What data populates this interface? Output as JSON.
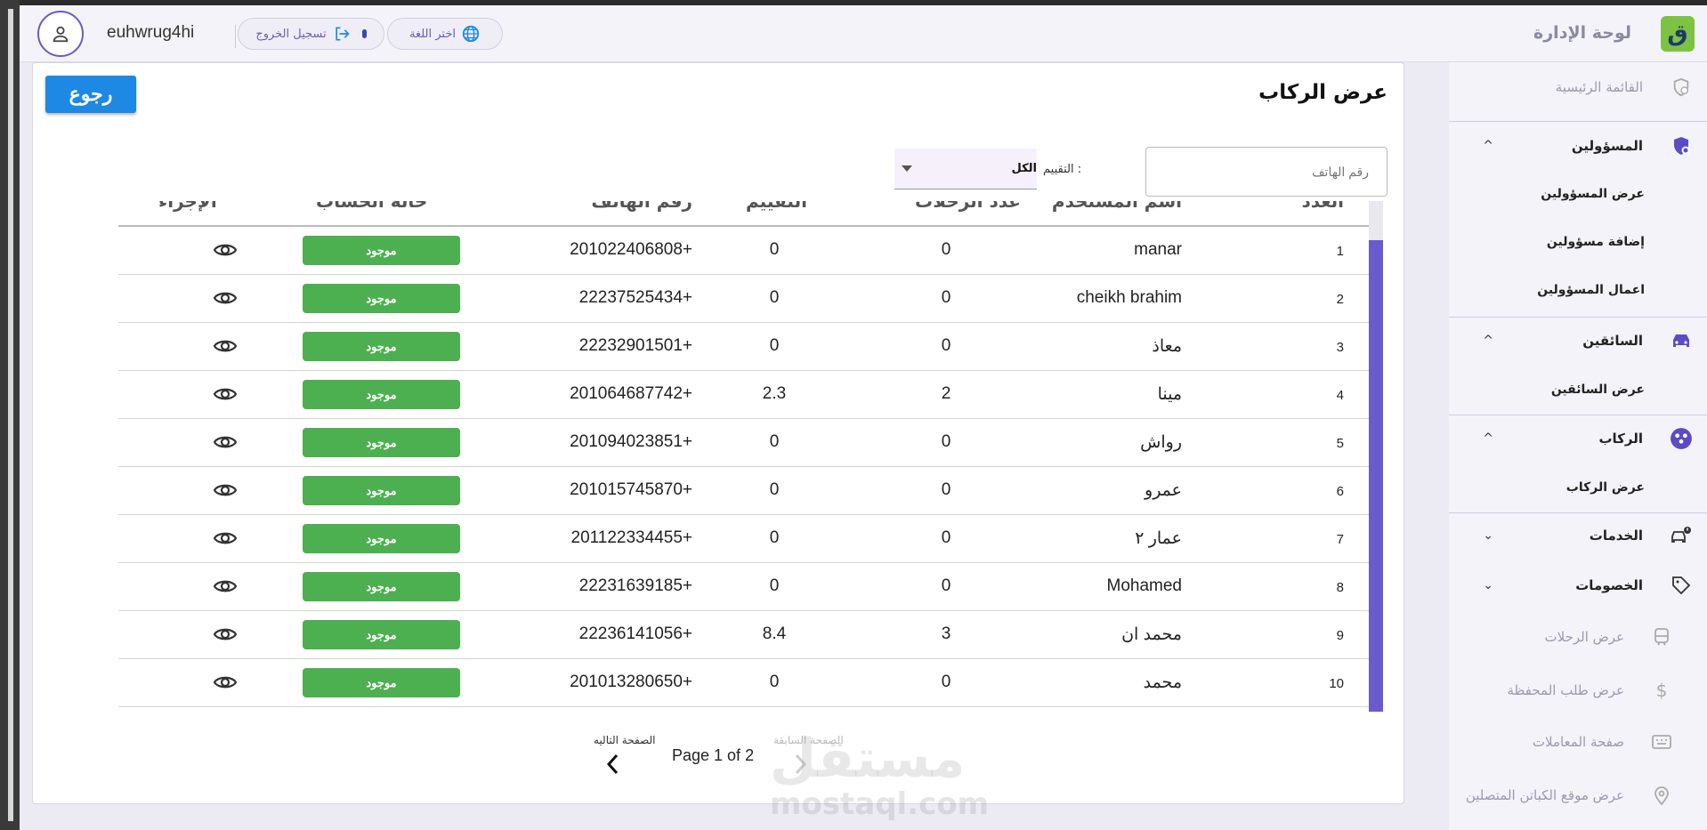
{
  "header": {
    "username": "euhwrug4hi",
    "logout_label": "تسجيل الخروج",
    "language_label": "اختر اللغة",
    "app_title": "لوحة الإدارة",
    "logo_text": "ق"
  },
  "sidebar": {
    "home": "القائمة الرئيسية",
    "admins": "المسؤولين",
    "admins_sub": [
      "عرض المسؤولين",
      "إضافة مسؤولين",
      "اعمال المسؤولين"
    ],
    "drivers": "السائقين",
    "drivers_sub": [
      "عرض السائقين"
    ],
    "riders": "الركاب",
    "riders_sub": [
      "عرض الركاب"
    ],
    "services": "الخدمات",
    "discounts": "الخصومات",
    "trips": "عرض الرحلات",
    "wallet": "عرض طلب المحفظة",
    "transactions": "صفحة المعاملات",
    "captains_location": "عرض  موقع الكباتن المتصلين"
  },
  "main": {
    "title": "عرض الركاب",
    "back_label": "رجوع",
    "phone_placeholder": "رقم الهاتف",
    "rating_label": "التقييم :",
    "rating_value": "الكل"
  },
  "table": {
    "columns": [
      "العدد",
      "اسم المستخدم",
      "عدد الرحلات",
      "التقييم",
      "رقم الهاتف",
      "حالة الحساب",
      "الإجراء"
    ],
    "rows": [
      {
        "idx": "1",
        "name": "manar",
        "trips": "0",
        "rating": "0",
        "phone": "201022406808+",
        "status": "موجود"
      },
      {
        "idx": "2",
        "name": "cheikh brahim",
        "trips": "0",
        "rating": "0",
        "phone": "22237525434+",
        "status": "موجود"
      },
      {
        "idx": "3",
        "name": "معاذ",
        "trips": "0",
        "rating": "0",
        "phone": "22232901501+",
        "status": "موجود"
      },
      {
        "idx": "4",
        "name": "مينا",
        "trips": "2",
        "rating": "2.3",
        "phone": "201064687742+",
        "status": "موجود"
      },
      {
        "idx": "5",
        "name": "رواش",
        "trips": "0",
        "rating": "0",
        "phone": "201094023851+",
        "status": "موجود"
      },
      {
        "idx": "6",
        "name": "عمرو",
        "trips": "0",
        "rating": "0",
        "phone": "201015745870+",
        "status": "موجود"
      },
      {
        "idx": "7",
        "name": "عمار ٢",
        "trips": "0",
        "rating": "0",
        "phone": "201122334455+",
        "status": "موجود"
      },
      {
        "idx": "8",
        "name": "Mohamed",
        "trips": "0",
        "rating": "0",
        "phone": "22231639185+",
        "status": "موجود"
      },
      {
        "idx": "9",
        "name": "محمد ان",
        "trips": "3",
        "rating": "8.4",
        "phone": "22236141056+",
        "status": "موجود"
      },
      {
        "idx": "10",
        "name": "محمد",
        "trips": "0",
        "rating": "0",
        "phone": "201013280650+",
        "status": "موجود"
      }
    ]
  },
  "pagination": {
    "text": "Page 1 of 2",
    "next_label": "الصفحة التاليه",
    "prev_label": "الصفحة السابقة"
  },
  "watermark": {
    "arabic": "مستقل",
    "latin": "mostaql.com"
  },
  "colors": {
    "accent": "#6a5acd",
    "primary_button": "#1e88e5",
    "status_ok": "#4caf50"
  }
}
